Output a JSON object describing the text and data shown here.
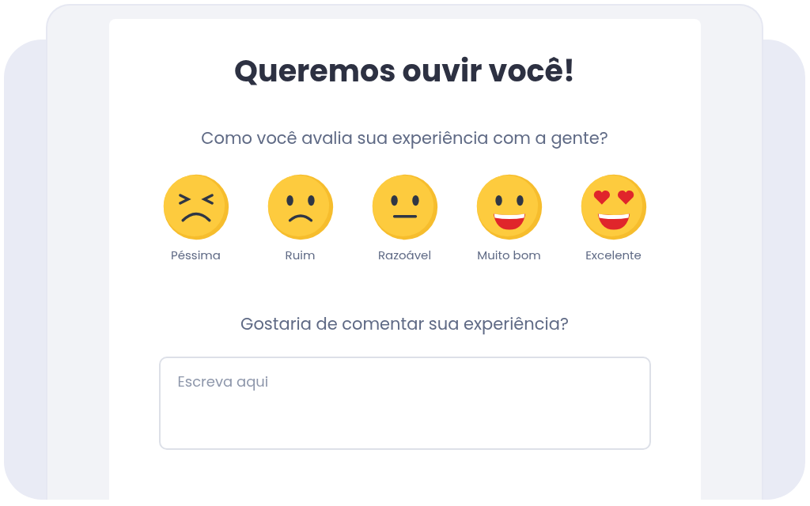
{
  "title": "Queremos ouvir você!",
  "rating_question": "Como você avalia sua experiência com a gente?",
  "ratings": [
    {
      "kind": "squint",
      "label": "Péssima"
    },
    {
      "kind": "sad",
      "label": "Ruim"
    },
    {
      "kind": "neutral",
      "label": "Razoável"
    },
    {
      "kind": "grin",
      "label": "Muito bom"
    },
    {
      "kind": "hearts",
      "label": "Excelente"
    }
  ],
  "comment_question": "Gostaria de comentar sua experiência?",
  "comment_field": {
    "placeholder": "Escreva aqui"
  }
}
